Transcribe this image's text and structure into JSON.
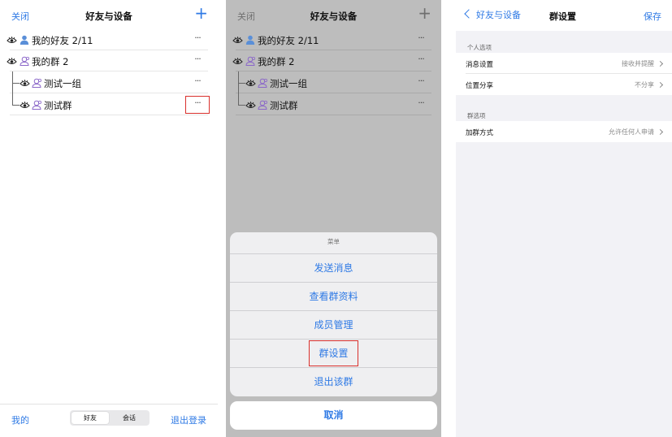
{
  "colors": {
    "accent": "#2f7ae5",
    "highlight": "#d9302c",
    "avatar_blue": "#5a8fd8",
    "avatar_purple": "#8b67c9"
  },
  "icons": {
    "eye": "eye-icon",
    "friend": "user-icon",
    "group": "group-icon",
    "more": "more-icon",
    "chevron": "chevron-right-icon"
  },
  "panel1": {
    "header": {
      "left": "关闭",
      "title": "好友与设备",
      "right": "+"
    },
    "tree": [
      {
        "label": "我的好友 2/11",
        "more": "···"
      },
      {
        "label": "我的群 2",
        "more": "···"
      },
      {
        "label": "测试一组",
        "more": "···"
      },
      {
        "label": "测试群",
        "more": "···"
      }
    ],
    "footer": {
      "left": "我的",
      "tab_active": "好友",
      "tab_other": "会话",
      "right": "退出登录"
    }
  },
  "panel2": {
    "header": {
      "left": "关闭",
      "title": "好友与设备",
      "right": "+"
    },
    "tree": [
      {
        "label": "我的好友 2/11",
        "more": "···"
      },
      {
        "label": "我的群 2",
        "more": "···"
      },
      {
        "label": "测试一组",
        "more": "···"
      },
      {
        "label": "测试群",
        "more": "···"
      }
    ],
    "sheet": {
      "title": "菜单",
      "options": [
        "发送消息",
        "查看群资料",
        "成员管理",
        "群设置",
        "退出该群"
      ],
      "cancel": "取消"
    }
  },
  "panel3": {
    "header": {
      "back": "好友与设备",
      "title": "群设置",
      "right": "保存"
    },
    "sections": [
      {
        "title": "个人选项",
        "rows": [
          {
            "key": "消息设置",
            "value": "接收并提醒"
          },
          {
            "key": "位置分享",
            "value": "不分享"
          }
        ]
      },
      {
        "title": "群选项",
        "rows": [
          {
            "key": "加群方式",
            "value": "允许任何人申请"
          }
        ]
      }
    ]
  }
}
